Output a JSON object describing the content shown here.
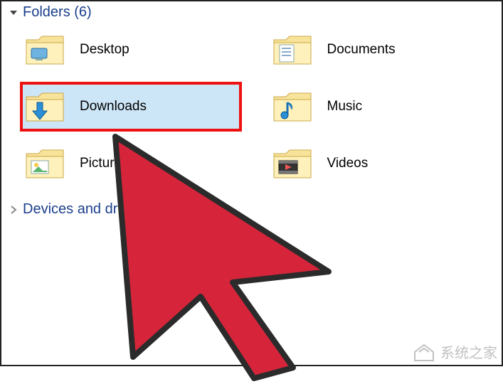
{
  "sections": {
    "folders": {
      "header": "Folders (6)",
      "expanded": true,
      "items": [
        {
          "label": "Desktop",
          "icon": "desktop",
          "selected": false
        },
        {
          "label": "Documents",
          "icon": "documents",
          "selected": false
        },
        {
          "label": "Downloads",
          "icon": "downloads",
          "selected": true
        },
        {
          "label": "Music",
          "icon": "music",
          "selected": false
        },
        {
          "label": "Pictures",
          "icon": "pictures",
          "selected": false
        },
        {
          "label": "Videos",
          "icon": "videos",
          "selected": false
        }
      ]
    },
    "devices": {
      "header": "Devices and drives (2)",
      "expanded": false
    }
  },
  "watermark": "系统之家",
  "cursor_color": "#d6253a",
  "cursor_outline": "#2b2b2b"
}
